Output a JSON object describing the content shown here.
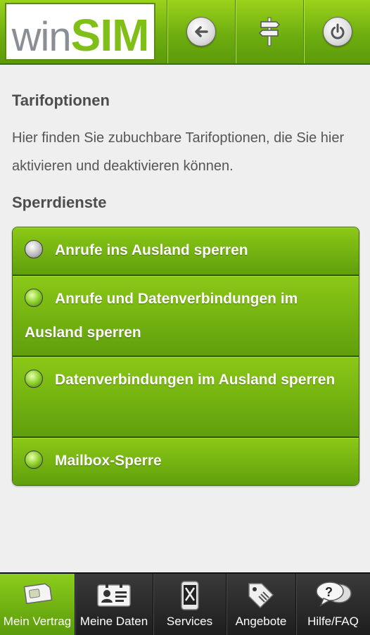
{
  "header": {
    "logo_win": "win",
    "logo_sim": "SIM",
    "buttons": [
      {
        "icon": "back-arrow-icon"
      },
      {
        "icon": "signpost-icon"
      },
      {
        "icon": "power-icon"
      }
    ]
  },
  "page": {
    "title": "Tarifoptionen",
    "intro": "Hier finden Sie zubuchbare Tarifoptionen, die Sie hier aktivieren und deaktivieren können.",
    "section_title": "Sperrdienste",
    "items": [
      {
        "label": "Anrufe ins Ausland sperren",
        "status_color": "#b8b8b8"
      },
      {
        "label": "Anrufe und Datenverbindungen im Ausland sperren",
        "status_color": "#8ccf2a"
      },
      {
        "label": "Datenverbindungen im Ausland sperren",
        "status_color": "#8ccf2a"
      },
      {
        "label": "Mailbox-Sperre",
        "status_color": "#8ccf2a"
      }
    ]
  },
  "nav": {
    "tabs": [
      {
        "label": "Mein Vertrag",
        "icon": "sim-card-icon",
        "active": true
      },
      {
        "label": "Meine Daten",
        "icon": "id-card-icon",
        "active": false
      },
      {
        "label": "Services",
        "icon": "phone-tools-icon",
        "active": false
      },
      {
        "label": "Angebote",
        "icon": "price-tag-icon",
        "active": false
      },
      {
        "label": "Hilfe/FAQ",
        "icon": "help-bubble-icon",
        "active": false
      }
    ]
  },
  "colors": {
    "brand_green": "#7fbf18",
    "header_green": "#6fae10",
    "nav_dark": "#2a2a2a"
  }
}
